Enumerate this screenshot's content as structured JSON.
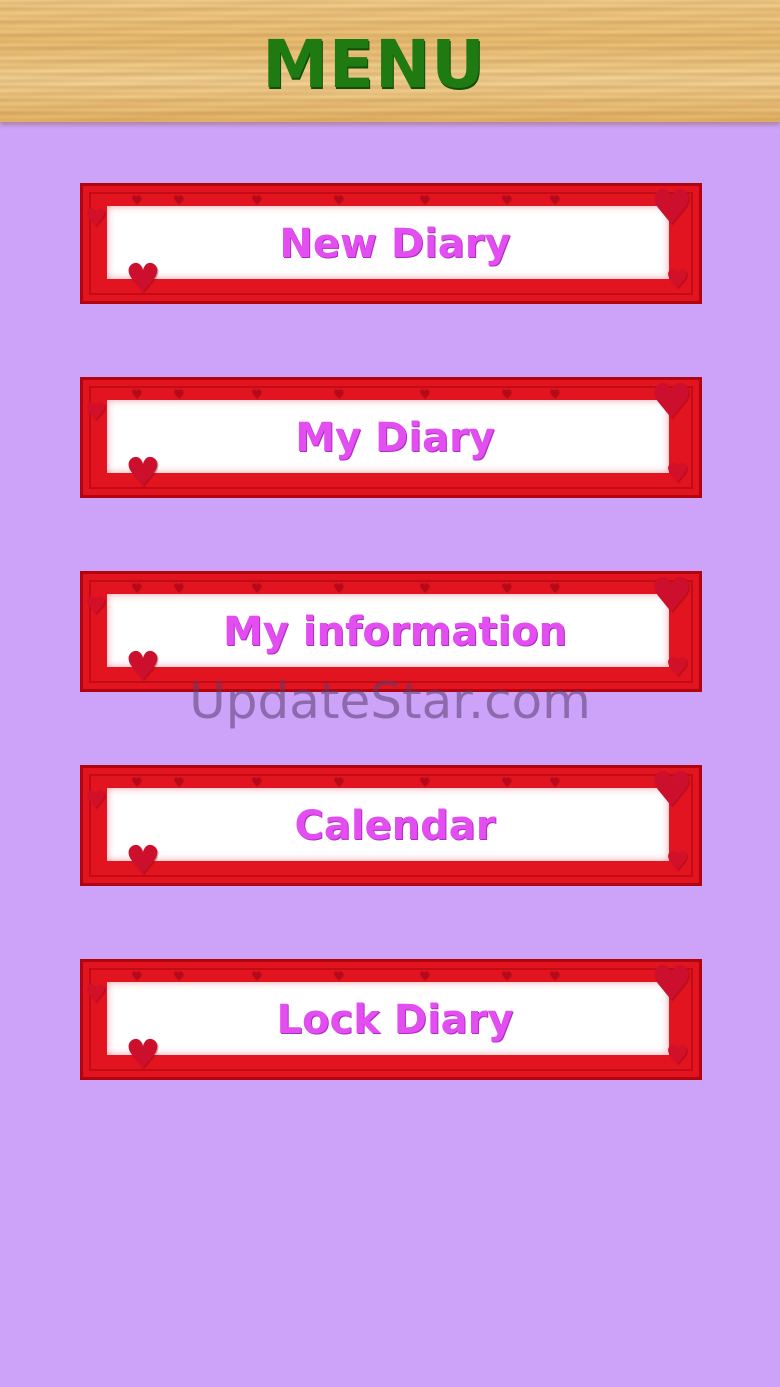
{
  "header": {
    "title": "MENU"
  },
  "menu": {
    "items": [
      {
        "label": "New Diary"
      },
      {
        "label": "My Diary"
      },
      {
        "label": "My information"
      },
      {
        "label": "Calendar"
      },
      {
        "label": "Lock Diary"
      }
    ]
  },
  "watermark": "UpdateStar.com",
  "colors": {
    "background": "#cca3f9",
    "title": "#1f7a12",
    "button_border": "#e1141f",
    "button_text": "#e34ef0"
  },
  "icons": [
    "heart-icon"
  ]
}
